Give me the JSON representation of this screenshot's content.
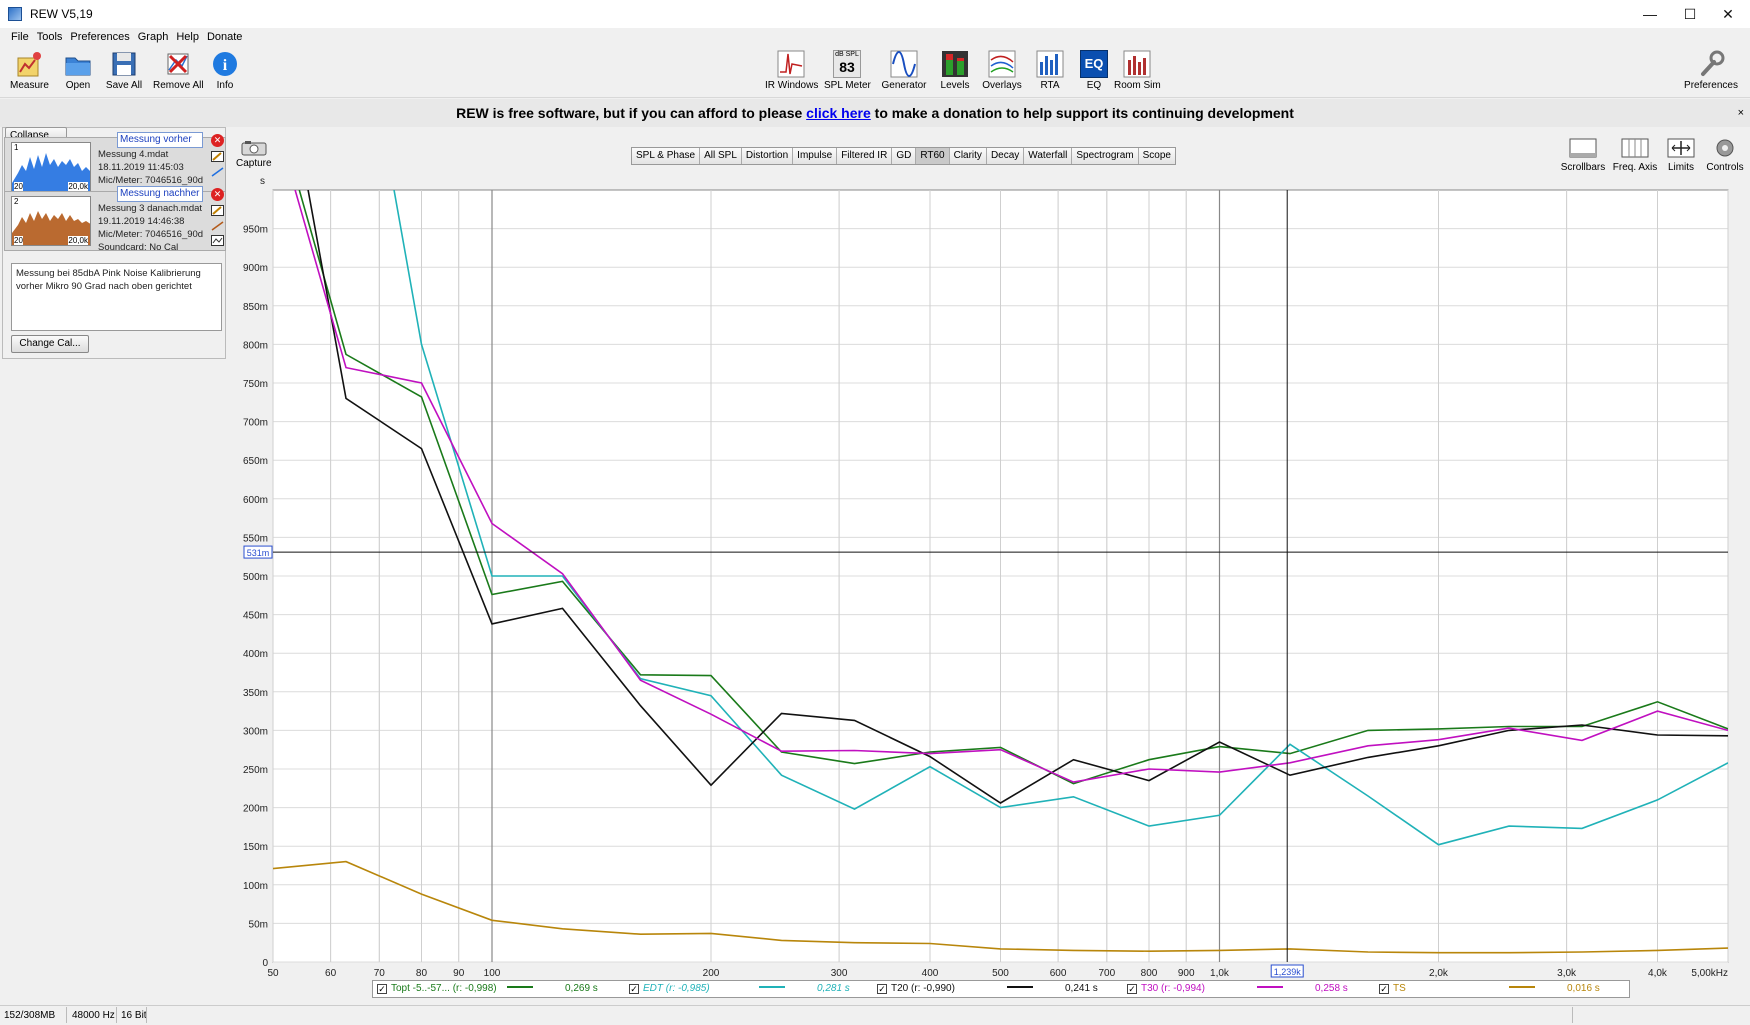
{
  "window": {
    "title": "REW V5,19",
    "controls": [
      "—",
      "☐",
      "✕"
    ]
  },
  "menu": [
    "File",
    "Tools",
    "Preferences",
    "Graph",
    "Help",
    "Donate"
  ],
  "toolbar_left": [
    {
      "label": "Measure",
      "icon": "measure-icon"
    },
    {
      "label": "Open",
      "icon": "folder-icon"
    },
    {
      "label": "Save All",
      "icon": "floppy-icon"
    },
    {
      "label": "Remove All",
      "icon": "remove-icon"
    },
    {
      "label": "Info",
      "icon": "info-icon"
    }
  ],
  "toolbar_center": [
    {
      "label": "IR Windows",
      "icon": "ir-windows-icon"
    },
    {
      "label": "SPL Meter",
      "icon": "spl-meter-icon",
      "badge_top": "dB SPL",
      "badge_value": "83"
    },
    {
      "label": "Generator",
      "icon": "generator-icon"
    },
    {
      "label": "Levels",
      "icon": "levels-icon"
    },
    {
      "label": "Overlays",
      "icon": "overlays-icon"
    },
    {
      "label": "RTA",
      "icon": "rta-icon"
    },
    {
      "label": "EQ",
      "icon": "eq-icon",
      "badge_value": "EQ"
    },
    {
      "label": "Room Sim",
      "icon": "room-sim-icon"
    }
  ],
  "toolbar_right": {
    "label": "Preferences",
    "icon": "wrench-icon"
  },
  "banner": {
    "before": "REW is free software, but if you can afford to please",
    "link": "click here",
    "after": "to make a donation to help support its continuing development",
    "close": "×"
  },
  "left_panel": {
    "collapse_label": "Collapse",
    "measurements": [
      {
        "name": "Messung vorher",
        "file": "Messung 4.mdat",
        "date": "18.11.2019 11:45:03",
        "mic": "Mic/Meter: 7046516_90d",
        "soundcard": "Soundcard: No Cal",
        "index": "1",
        "thumb_min": "20",
        "thumb_max": "20,0k",
        "color": "#1f6fe0"
      },
      {
        "name": "Messung nachher",
        "file": "Messung 3 danach.mdat",
        "date": "19.11.2019 14:46:38",
        "mic": "Mic/Meter: 7046516_90d",
        "soundcard": "Soundcard: No Cal",
        "index": "2",
        "thumb_min": "20",
        "thumb_max": "20,0k",
        "color": "#b35a1a"
      }
    ],
    "notes": "Messung bei 85dbA Pink Noise Kalibrierung vorher Mikro 90 Grad nach oben gerichtet",
    "change_cal_label": "Change Cal..."
  },
  "graph_toolbar": {
    "capture_label": "Capture",
    "tabs": [
      "SPL & Phase",
      "All SPL",
      "Distortion",
      "Impulse",
      "Filtered IR",
      "GD",
      "RT60",
      "Clarity",
      "Decay",
      "Waterfall",
      "Spectrogram",
      "Scope"
    ],
    "active_tab": "RT60",
    "right_tools": [
      {
        "label": "Scrollbars",
        "icon": "scrollbars-icon"
      },
      {
        "label": "Freq. Axis",
        "icon": "freq-axis-icon"
      },
      {
        "label": "Limits",
        "icon": "limits-icon"
      },
      {
        "label": "Controls",
        "icon": "gear-icon"
      }
    ]
  },
  "chart_data": {
    "type": "line",
    "xscale": "log",
    "xlim": [
      50,
      5000
    ],
    "ylim": [
      0,
      1.0
    ],
    "yunit": "s",
    "yticks": [
      0,
      0.05,
      0.1,
      0.15,
      0.2,
      0.25,
      0.3,
      0.35,
      0.4,
      0.45,
      0.5,
      0.55,
      0.6,
      0.65,
      0.7,
      0.75,
      0.8,
      0.85,
      0.9,
      0.95
    ],
    "ytick_labels": [
      "0",
      "50m",
      "100m",
      "150m",
      "200m",
      "250m",
      "300m",
      "350m",
      "400m",
      "450m",
      "500m",
      "550m",
      "600m",
      "650m",
      "700m",
      "750m",
      "800m",
      "850m",
      "900m",
      "950m"
    ],
    "xticks": [
      50,
      60,
      70,
      80,
      90,
      100,
      200,
      300,
      400,
      500,
      600,
      700,
      800,
      900,
      1000,
      2000,
      3000,
      4000,
      5000
    ],
    "xtick_labels": [
      "50",
      "60",
      "70",
      "80",
      "90",
      "100",
      "200",
      "300",
      "400",
      "500",
      "600",
      "700",
      "800",
      "900",
      "1,0k",
      "2,0k",
      "3,0k",
      "4,0k",
      "5,00kHz"
    ],
    "bold_xticks": [
      100,
      1000
    ],
    "cursor": {
      "x": 1239,
      "y": 0.531,
      "x_label": "1,239k",
      "y_label": "531m"
    },
    "x": [
      50,
      63,
      80,
      100,
      125,
      160,
      200,
      250,
      315,
      400,
      500,
      630,
      800,
      1000,
      1250,
      1600,
      2000,
      2500,
      3150,
      4000,
      5000
    ],
    "series": [
      {
        "name": "Topt -5..-57... (r: -0,998)",
        "value": "0,269 s",
        "color": "#1a7a1a",
        "values": [
          1.12,
          0.787,
          0.732,
          0.476,
          0.493,
          0.372,
          0.371,
          0.272,
          0.257,
          0.272,
          0.278,
          0.231,
          0.262,
          0.279,
          0.27,
          0.3,
          0.302,
          0.305,
          0.305,
          0.337,
          0.302
        ]
      },
      {
        "name": "EDT (r: -0,985)",
        "value": "0,281 s",
        "color": "#20b2b8",
        "values": [
          1.6,
          1.35,
          0.8,
          0.5,
          0.5,
          0.367,
          0.345,
          0.242,
          0.198,
          0.253,
          0.2,
          0.214,
          0.176,
          0.19,
          0.282,
          0.215,
          0.152,
          0.176,
          0.173,
          0.21,
          0.258
        ]
      },
      {
        "name": "T20 (r: -0,990)",
        "value": "0,241 s",
        "color": "#111111",
        "values": [
          1.25,
          0.73,
          0.665,
          0.438,
          0.458,
          0.332,
          0.229,
          0.322,
          0.313,
          0.266,
          0.206,
          0.262,
          0.235,
          0.285,
          0.242,
          0.265,
          0.28,
          0.3,
          0.307,
          0.294,
          0.293
        ]
      },
      {
        "name": "T30 (r: -0,994)",
        "value": "0,258 s",
        "color": "#c010c0",
        "values": [
          1.1,
          0.77,
          0.75,
          0.568,
          0.503,
          0.365,
          0.321,
          0.273,
          0.274,
          0.27,
          0.275,
          0.233,
          0.25,
          0.246,
          0.258,
          0.28,
          0.288,
          0.303,
          0.287,
          0.325,
          0.3
        ]
      },
      {
        "name": "TS",
        "value": "0,016 s",
        "color": "#b8860b",
        "values": [
          0.121,
          0.13,
          0.088,
          0.054,
          0.043,
          0.036,
          0.037,
          0.028,
          0.025,
          0.024,
          0.017,
          0.015,
          0.014,
          0.015,
          0.017,
          0.013,
          0.012,
          0.012,
          0.013,
          0.015,
          0.018
        ]
      }
    ]
  },
  "status": {
    "memory": "152/308MB",
    "rate": "48000 Hz",
    "bits": "16 Bit"
  }
}
